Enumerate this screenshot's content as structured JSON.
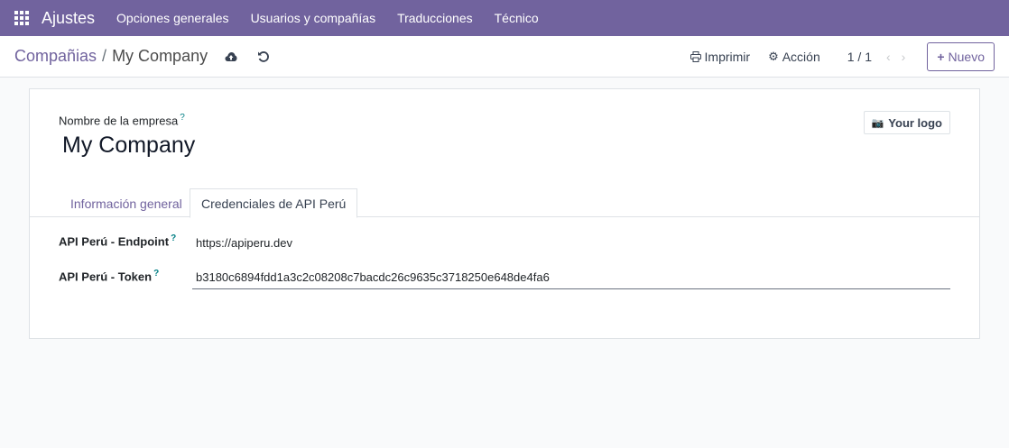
{
  "navbar": {
    "brand": "Ajustes",
    "items": [
      "Opciones generales",
      "Usuarios y compañías",
      "Traducciones",
      "Técnico"
    ]
  },
  "breadcrumb": {
    "parent": "Compañias",
    "separator": "/",
    "current": "My Company"
  },
  "toolbar": {
    "print_label": "Imprimir",
    "action_label": "Acción",
    "pager": "1 / 1",
    "new_label": "Nuevo"
  },
  "form": {
    "company_label": "Nombre de la empresa",
    "help_mark": "?",
    "company_name": "My Company",
    "logo_label": "Your logo",
    "tabs": [
      "Información general",
      "Credenciales de API Perú"
    ],
    "active_tab": "Credenciales de API Perú",
    "fields": [
      {
        "label": "API Perú - Endpoint",
        "value": "https://apiperu.dev"
      },
      {
        "label": "API Perú - Token",
        "value": "b3180c6894fdd1a3c2c08208c7bacdc26c9635c3718250e648de4fa6"
      }
    ]
  },
  "colors": {
    "brand": "#71639e",
    "teal_help": "#017e84"
  },
  "icons": [
    "apps-grid-icon",
    "cloud-upload-icon",
    "undo-icon",
    "print-icon",
    "gear-icon",
    "chevron-left-icon",
    "chevron-right-icon",
    "plus-icon",
    "camera-icon"
  ]
}
